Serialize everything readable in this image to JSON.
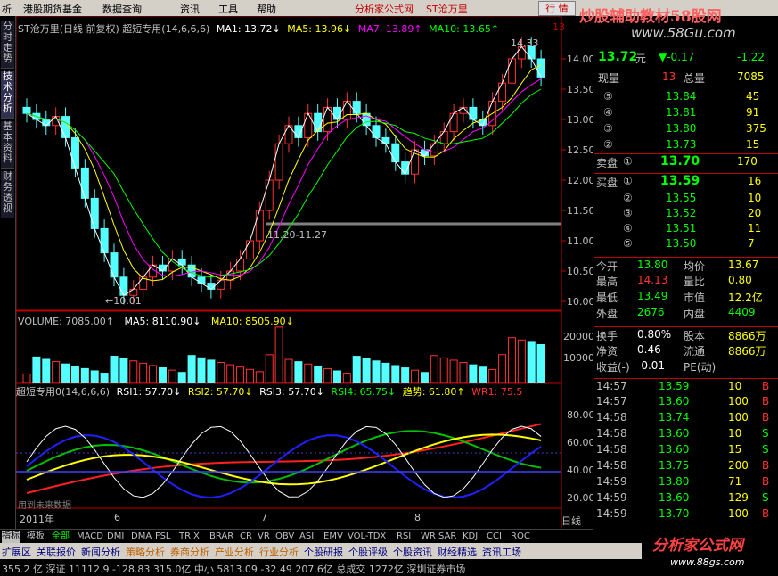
{
  "menu": {
    "items": [
      "析",
      "港股期货基金",
      "数据查询",
      "资讯",
      "工具",
      "帮助"
    ],
    "title_links": [
      "分析家公式网",
      "ST沧万里"
    ],
    "trade_button": "行 情"
  },
  "watermark": {
    "top_text": "炒股辅助教材58股网",
    "url_top": "www.58Gu.com",
    "bottom_text": "分析家公式网",
    "url_bottom": "www.88gs.com"
  },
  "side_tabs": [
    "分时走势",
    "技术分析",
    "基本资料",
    "财务透视"
  ],
  "main_chart": {
    "header": "ST沧万里(日线 前复权) 超短专用(14,6,6,6)",
    "ma1": "MA1: 13.72↓",
    "ma5": "MA5: 13.96↓",
    "ma7": "MA7: 13.89↑",
    "ma10": "MA10: 13.65↑",
    "corner": "13",
    "high_label": "14.33",
    "low_label": "←10.01",
    "range_label": "11.20-11.27",
    "y_ticks": [
      "14.00",
      "13.50",
      "13.00",
      "12.50",
      "12.00",
      "11.50",
      "11.00",
      "10.50",
      "10.00"
    ]
  },
  "volume_chart": {
    "header": "VOLUME: 7085.00↑",
    "ma5": "MA5: 8110.90↓",
    "ma10": "MA10: 8505.90↓",
    "y_ticks": [
      "20000",
      "10000"
    ]
  },
  "indicator_chart": {
    "header": "超短专用0(14,6,6,6)",
    "rsi1": "RSI1: 57.70↓",
    "rsi2": "RSI2: 57.70↓",
    "rsi3": "RSI3: 57.70↓",
    "rsi4": "RSI4: 65.75↓",
    "trend": "趋势: 61.80↑",
    "wr1": "WR1: 75.5",
    "y_ticks": [
      "80.00",
      "60.00",
      "40.00",
      "20.00"
    ],
    "footnote": "用到未来数据"
  },
  "x_axis": [
    "2011年",
    "6",
    "7",
    "8"
  ],
  "x_axis_right": "日线",
  "quote": {
    "price": "13.72",
    "unit": "元",
    "change": "▼-0.17",
    "change_pct": "-1.22",
    "xianliang_label": "现量",
    "xianliang": "13",
    "zongliang_label": "总量",
    "zongliang": "7085",
    "sell_levels": [
      {
        "lvl": "⑤",
        "price": "13.84",
        "vol": "45"
      },
      {
        "lvl": "④",
        "price": "13.81",
        "vol": "91"
      },
      {
        "lvl": "③",
        "price": "13.80",
        "vol": "375"
      },
      {
        "lvl": "②",
        "price": "13.73",
        "vol": "15"
      }
    ],
    "sell1_label": "卖盘",
    "sell1_lvl": "①",
    "sell1_price": "13.70",
    "sell1_vol": "170",
    "buy1_label": "买盘",
    "buy1_lvl": "①",
    "buy1_price": "13.59",
    "buy1_vol": "16",
    "buy_levels": [
      {
        "lvl": "②",
        "price": "13.55",
        "vol": "10"
      },
      {
        "lvl": "③",
        "price": "13.52",
        "vol": "20"
      },
      {
        "lvl": "④",
        "price": "13.51",
        "vol": "11"
      },
      {
        "lvl": "⑤",
        "price": "13.50",
        "vol": "7"
      }
    ],
    "stats": [
      [
        "今开",
        "13.80",
        "均价",
        "13.67"
      ],
      [
        "最高",
        "14.13",
        "量比",
        "0.80"
      ],
      [
        "最低",
        "13.49",
        "市值",
        "12.2亿"
      ],
      [
        "外盘",
        "2676",
        "内盘",
        "4409"
      ]
    ],
    "stats2": [
      [
        "换手",
        "0.80%",
        "股本",
        "8866万"
      ],
      [
        "净资",
        "0.46",
        "流通",
        "8866万"
      ],
      [
        "收益(-)",
        "-0.01",
        "PE(动)",
        "—"
      ]
    ],
    "ticks": [
      [
        "14:57",
        "13.59",
        "10",
        "B"
      ],
      [
        "14:57",
        "13.60",
        "100",
        "B"
      ],
      [
        "14:58",
        "13.74",
        "100",
        "B"
      ],
      [
        "14:58",
        "13.60",
        "10",
        "S"
      ],
      [
        "14:58",
        "13.60",
        "15",
        "S"
      ],
      [
        "14:58",
        "13.75",
        "200",
        "B"
      ],
      [
        "14:59",
        "13.80",
        "71",
        "B"
      ],
      [
        "14:59",
        "13.60",
        "129",
        "S"
      ],
      [
        "14:59",
        "13.70",
        "100",
        "B"
      ]
    ]
  },
  "indicator_tabs": [
    "指标",
    "模板",
    "全部",
    "MACD",
    "DMI",
    "DMA",
    "FSL",
    "TRIX",
    "BRAR",
    "CR",
    "VR",
    "OBV",
    "ASI",
    "EMV",
    "VOL-TDX",
    "RSI",
    "WR",
    "SAR",
    "KDJ",
    "CCI",
    "ROC"
  ],
  "bottom_tabs": [
    "扩展区",
    "关联报价",
    "新闻分析",
    "策略分析",
    "券商分析",
    "产业分析",
    "行业分析",
    "个股研报",
    "个股评级",
    "个股资讯",
    "财经精选",
    "资讯工场"
  ],
  "status_text": "355.2  亿  深证  11112.9  -128.83  315.0亿  中小  5813.09  -32.49  207.6亿  总成交  1272亿  深圳证券市场",
  "colors": {
    "up": "#ff3232",
    "down": "#54ffff",
    "ma1": "#ffffff",
    "ma5": "#ffff00",
    "ma7": "#ff00ff",
    "ma10": "#00ff00"
  }
}
